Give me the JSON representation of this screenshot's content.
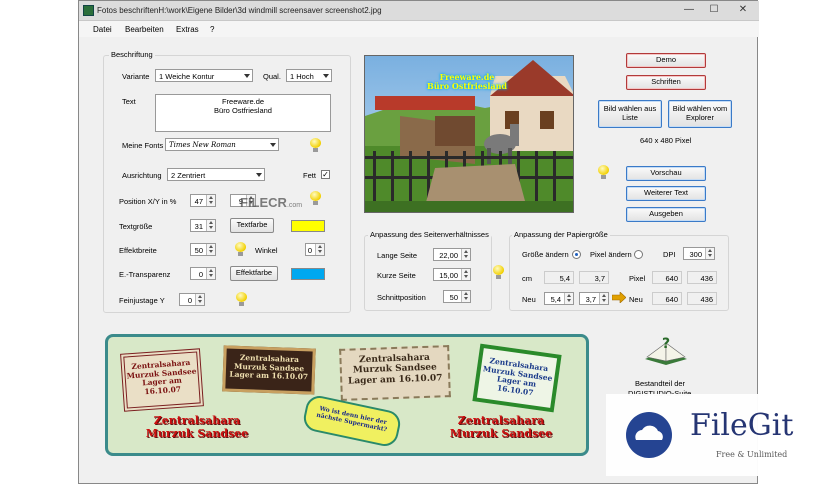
{
  "window": {
    "title": "Fotos beschriftenH:\\work\\Eigene Bilder\\3d windmill screensaver screenshot2.jpg",
    "minimize": "—",
    "maximize": "☐",
    "close": "✕"
  },
  "menu": [
    "Datei",
    "Bearbeiten",
    "Extras",
    "?"
  ],
  "beschriftung": {
    "group_label": "Beschriftung",
    "variante_label": "Variante",
    "variante_value": "1 Weiche Kontur",
    "qual_label": "Qual.",
    "qual_value": "1 Hoch",
    "text_label": "Text",
    "text_line1": "Freeware.de",
    "text_line2": "Büro Ostfriesland",
    "fonts_label": "Meine Fonts",
    "font_value": "Times New Roman",
    "ausrichtung_label": "Ausrichtung",
    "ausrichtung_value": "2 Zentriert",
    "fett_label": "Fett",
    "fett_checked": "✓",
    "position_label": "Position X/Y in %",
    "pos_x": "47",
    "pos_y": "9",
    "textgroesse_label": "Textgröße",
    "textgroesse_value": "31",
    "textfarbe_button": "Textfarbe",
    "textfarbe_color": "#ffff00",
    "effektbreite_label": "Effektbreite",
    "effektbreite_value": "50",
    "winkel_label": "Winkel",
    "winkel_value": "0",
    "transparenz_label": "E.-Transparenz",
    "transparenz_value": "0",
    "effektfarbe_button": "Effektfarbe",
    "effektfarbe_color": "#00a8f0",
    "feinjustage_label": "Feinjustage Y",
    "feinjustage_value": "0"
  },
  "right_buttons": {
    "demo": "Demo",
    "schriften": "Schriften",
    "bild_liste": "Bild wählen aus Liste",
    "bild_explorer": "Bild wählen vom Explorer",
    "resolution": "640 x 480 Pixel",
    "vorschau": "Vorschau",
    "weiterer_text": "Weiterer Text",
    "ausgeben": "Ausgeben"
  },
  "preview": {
    "sign_line1": "Freeware.de",
    "sign_line2": "Büro Ostfriesland"
  },
  "seitenverhaeltnis": {
    "group_label": "Anpassung des Seitenverhältnisses",
    "lange_label": "Lange Seite",
    "lange_value": "22,00",
    "kurze_label": "Kurze Seite",
    "kurze_value": "15,00",
    "schnitt_label": "Schnittposition",
    "schnitt_value": "50"
  },
  "papiergroesse": {
    "group_label": "Anpassung der Papiergröße",
    "groesse_aendern": "Größe ändern",
    "pixel_aendern": "Pixel ändern",
    "dpi_label": "DPI",
    "dpi_value": "300",
    "cm_label": "cm",
    "cm_w": "5,4",
    "cm_h": "3,7",
    "pixel_label": "Pixel",
    "px_w": "640",
    "px_h": "436",
    "neu_label": "Neu",
    "neu_w": "5,4",
    "neu_h": "3,7",
    "neu2_label": "Neu",
    "neu_px_w": "640",
    "neu_px_h": "436"
  },
  "banner": {
    "card1": [
      "Zentralsahara",
      "Murzuk Sandsee",
      "Lager am 16.10.07"
    ],
    "card2": [
      "Zentralsahara",
      "Murzuk Sandsee",
      "Lager am 16.10.07"
    ],
    "card3": [
      "Zentralsahara",
      "Murzuk Sandsee",
      "Lager am 16.10.07"
    ],
    "card4": [
      "Zentralsahara",
      "Murzuk Sandsee",
      "Lager am 16.10.07"
    ],
    "card5": [
      "Wo ist denn hier der",
      "nächste Supermarkt?"
    ],
    "red_text_left": [
      "Zentralsahara",
      "Murzuk Sandsee"
    ],
    "red_text_right": [
      "Zentralsahara",
      "Murzuk Sandsee"
    ]
  },
  "bestandteil": {
    "line1": "Bestandteil der",
    "line2": "DIGISTUDIO-Suite"
  },
  "watermark_filecr": "FILECR",
  "watermark_filecr_com": ".com",
  "watermark_filegit": "FileGit",
  "watermark_filegit_sub": "Free & Unlimited"
}
